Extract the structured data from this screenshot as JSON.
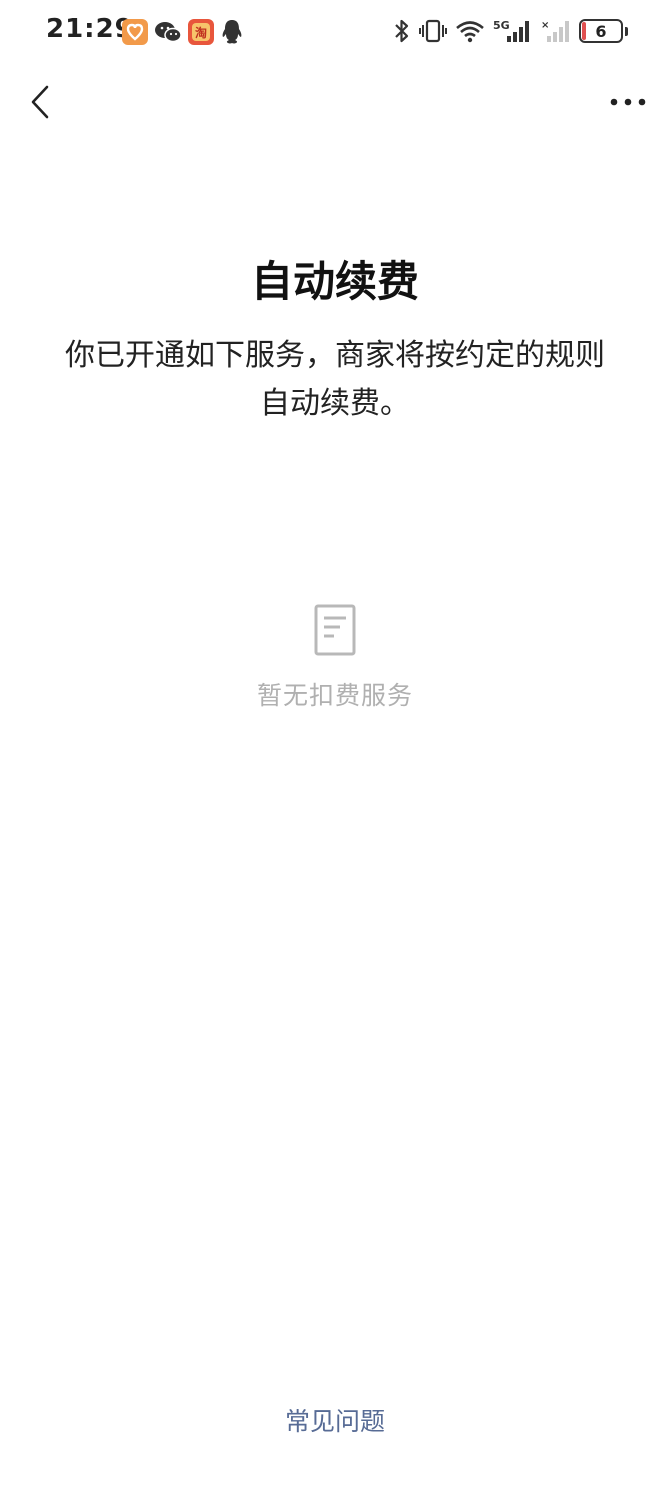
{
  "status_bar": {
    "time": "21:29",
    "battery_level": "6",
    "notification_icons": [
      "health-app-icon",
      "wechat-icon",
      "taobao-icon",
      "qq-icon"
    ],
    "system_icons": [
      "bluetooth-icon",
      "vibrate-icon",
      "wifi-icon",
      "signal-5g-icon",
      "signal-no-sim-icon",
      "battery-icon"
    ]
  },
  "nav": {
    "back_icon": "chevron-left-icon",
    "more_icon": "more-dots-icon"
  },
  "header": {
    "title": "自动续费",
    "description": "你已开通如下服务，商家将按约定的规则自动续费。"
  },
  "empty_state": {
    "icon": "document-icon",
    "text": "暂无扣费服务"
  },
  "footer": {
    "faq_label": "常见问题"
  },
  "colors": {
    "link": "#576b95",
    "empty_text": "#b0b0b0",
    "battery_low": "#e05050"
  }
}
